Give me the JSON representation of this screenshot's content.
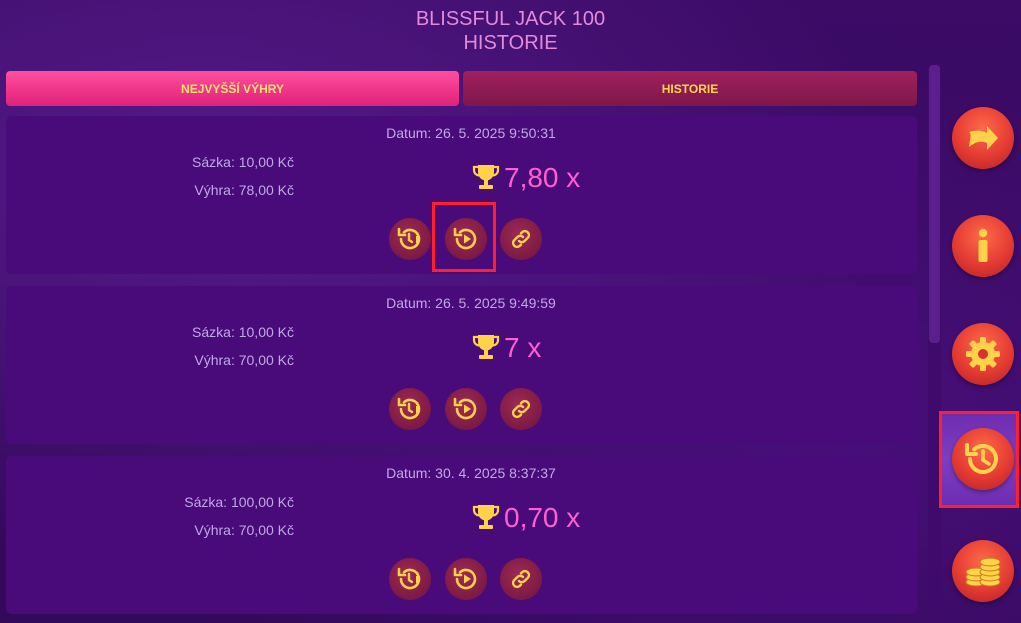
{
  "header": {
    "game_title": "BLISSFUL JACK 100",
    "page_title": "HISTORIE"
  },
  "tabs": [
    {
      "label": "NEJVYŠŠÍ VÝHRY",
      "active": true
    },
    {
      "label": "HISTORIE",
      "active": false
    }
  ],
  "entries": [
    {
      "date": "Datum: 26. 5. 2025 9:50:31",
      "bet": "Sázka: 10,00 Kč",
      "win": "Výhra: 78,00 Kč",
      "multiplier": "7,80 x"
    },
    {
      "date": "Datum: 26. 5. 2025 9:49:59",
      "bet": "Sázka: 10,00 Kč",
      "win": "Výhra: 70,00 Kč",
      "multiplier": "7 x"
    },
    {
      "date": "Datum: 30. 4. 2025 8:37:37",
      "bet": "Sázka: 100,00 Kč",
      "win": "Výhra: 70,00 Kč",
      "multiplier": "0,70 x"
    }
  ],
  "entry_actions": [
    "history-details-icon",
    "replay-icon",
    "link-icon"
  ],
  "sidebar": [
    "arrow-exit-icon",
    "info-icon",
    "gear-icon",
    "history-icon",
    "coins-icon"
  ],
  "highlights": {
    "replay_button_row": 0,
    "sidebar_button": "history-icon",
    "color": "#ff1f2d"
  },
  "colors": {
    "accent_pink": "#ff5fd0",
    "gold": "#ffd84a",
    "card": "#4a0b7a",
    "background": "#3a0a63"
  }
}
